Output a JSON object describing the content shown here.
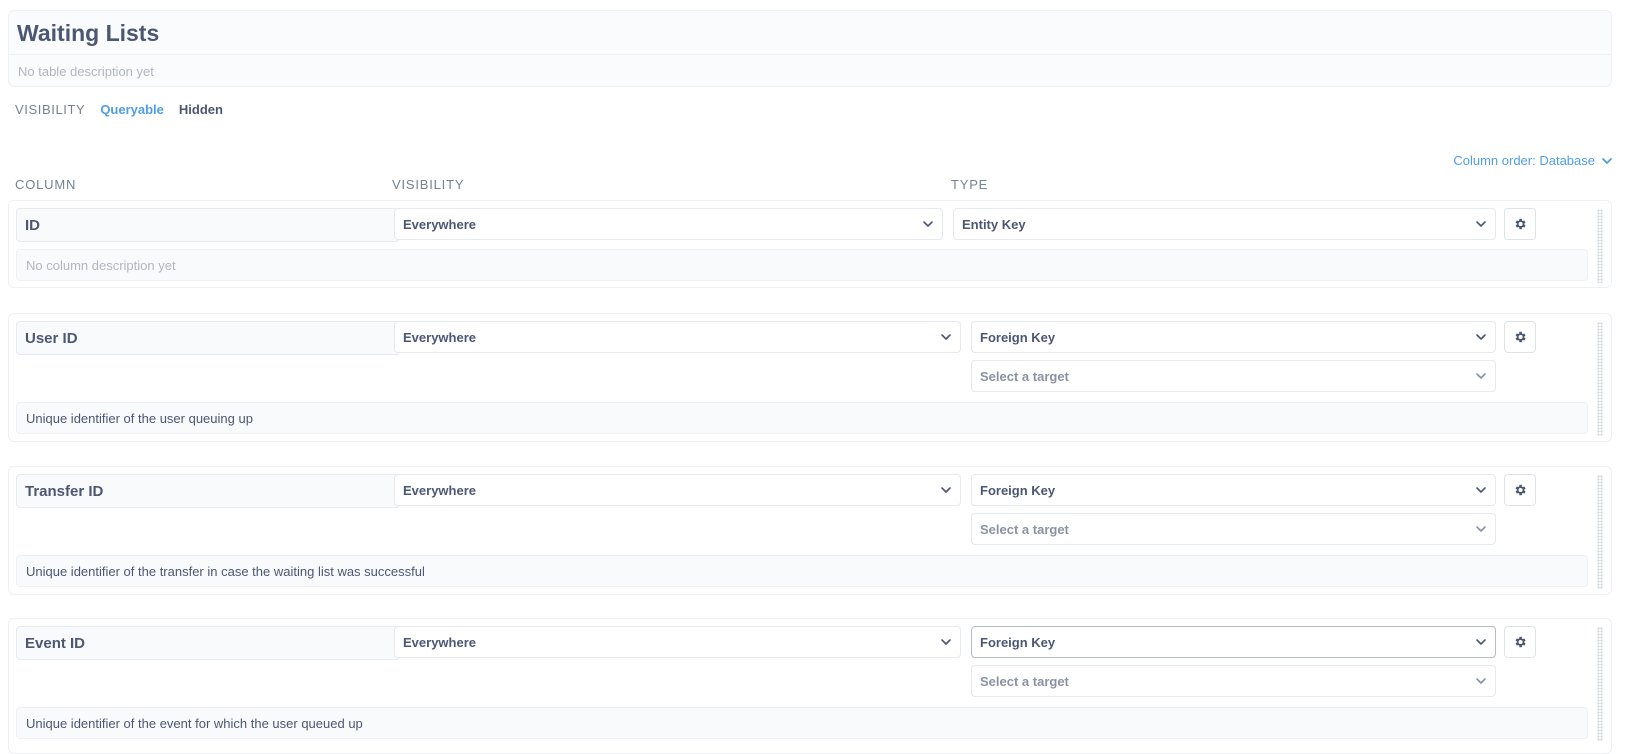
{
  "table": {
    "title": "Waiting Lists",
    "description_placeholder": "No table description yet"
  },
  "visibility": {
    "label": "VISIBILITY",
    "options": [
      "Queryable",
      "Hidden"
    ],
    "selected": "Queryable"
  },
  "column_order": {
    "label": "Column order: Database",
    "icon": "chevron-down-icon"
  },
  "column_headers": {
    "column": "COLUMN",
    "visibility": "VISIBILITY",
    "type": "TYPE"
  },
  "columns": [
    {
      "name": "ID",
      "visibility": "Everywhere",
      "type": "Entity Key",
      "description": "No column description yet"
    },
    {
      "name": "User ID",
      "visibility": "Everywhere",
      "type": "Foreign Key",
      "target_placeholder": "Select a target",
      "description": "Unique identifier of the user queuing up"
    },
    {
      "name": "Transfer ID",
      "visibility": "Everywhere",
      "type": "Foreign Key",
      "target_placeholder": "Select a target",
      "description": "Unique identifier of the transfer in case the waiting list was successful"
    },
    {
      "name": "Event ID",
      "visibility": "Everywhere",
      "type": "Foreign Key",
      "target_placeholder": "Select a target",
      "description": "Unique identifier of the event for which the user queued up"
    }
  ],
  "colors": {
    "accent": "#509ee3",
    "text": "#4c5773",
    "muted": "#b0b6c0",
    "border": "#eef0f3"
  }
}
